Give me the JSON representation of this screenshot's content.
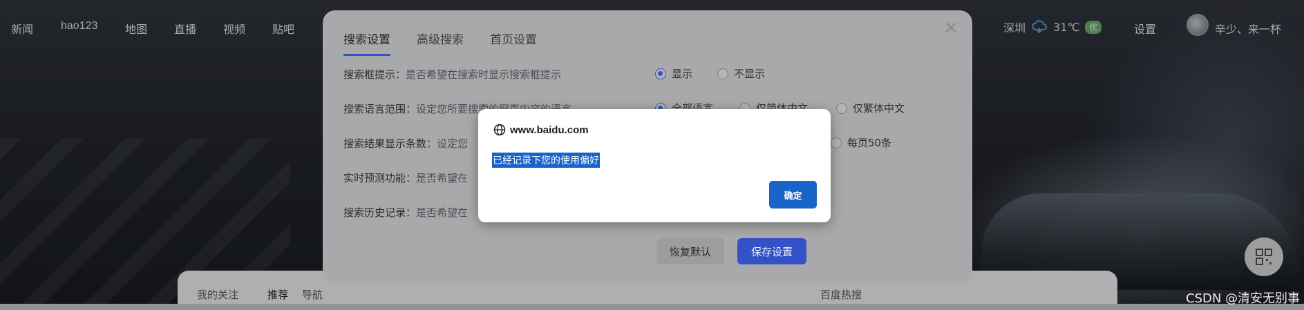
{
  "topnav": {
    "left_links": [
      "新闻",
      "hao123",
      "地图",
      "直播",
      "视频",
      "贴吧"
    ],
    "city": "深圳",
    "temperature": "31℃",
    "air_quality": "优",
    "settings": "设置",
    "username": "辛少、来一杯"
  },
  "settings_modal": {
    "tabs": [
      "搜索设置",
      "高级搜索",
      "首页设置"
    ],
    "active_tab": "搜索设置",
    "rows": [
      {
        "label": "搜索框提示：",
        "desc": "是否希望在搜索时显示搜索框提示"
      },
      {
        "label": "搜索语言范围：",
        "desc": "设定您所要搜索的网页内容的语言"
      },
      {
        "label": "搜索结果显示条数：",
        "desc": "设定您"
      },
      {
        "label": "实时预测功能：",
        "desc": "是否希望在"
      },
      {
        "label": "搜索历史记录：",
        "desc": "是否希望在"
      }
    ],
    "options": {
      "suggest_show": "显示",
      "suggest_hide": "不显示",
      "lang_all": "全部语言",
      "lang_simplified": "仅简体中文",
      "lang_traditional": "仅繁体中文",
      "per_page_50": "每页50条"
    },
    "restore_button": "恢复默认",
    "save_button": "保存设置"
  },
  "alert": {
    "origin": "www.baidu.com",
    "message": "已经记录下您的使用偏好",
    "ok_button": "确定"
  },
  "bottom_card": {
    "tabs": [
      "我的关注",
      "推荐",
      "导航"
    ],
    "hot_title": "百度热搜"
  },
  "watermark": "CSDN @清安无别事"
}
